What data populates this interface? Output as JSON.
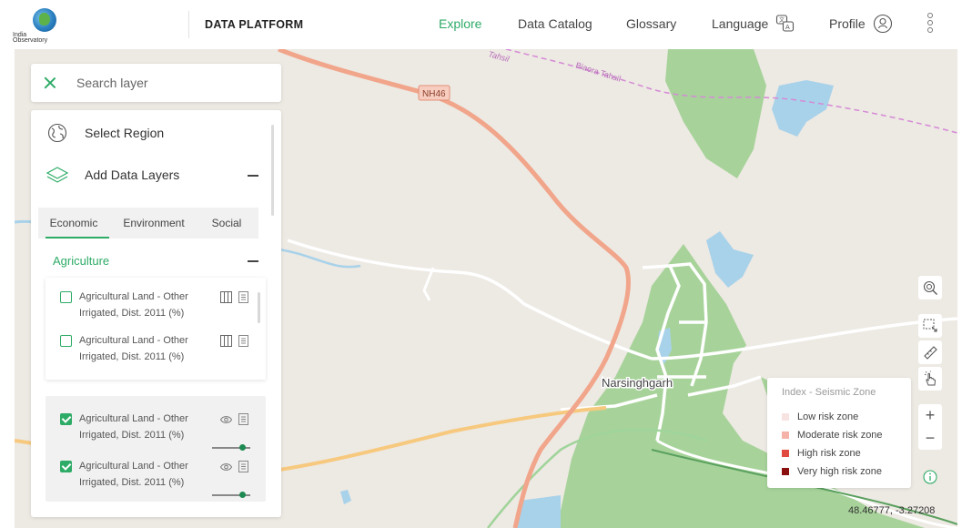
{
  "header": {
    "logo_line1": "India",
    "logo_line2": "Observatory",
    "brand": "DATA PLATFORM",
    "nav": [
      {
        "label": "Explore",
        "active": true
      },
      {
        "label": "Data Catalog"
      },
      {
        "label": "Glossary"
      },
      {
        "label": "Language"
      },
      {
        "label": "Profile"
      }
    ]
  },
  "map_labels": {
    "tahsil_fragment": "Tahsil",
    "biaora": "Biaora Tahsil",
    "highway": "NH46",
    "town": "Narsinghgarh"
  },
  "search": {
    "placeholder": "Search layer"
  },
  "panel": {
    "select_region": "Select Region",
    "add_layers": "Add Data Layers",
    "tabs": [
      "Economic",
      "Environment",
      "Social"
    ],
    "category": "Agriculture",
    "available_layers": [
      {
        "line1": "Agricultural Land - Other",
        "line2": "Irrigated, Dist. 2011 (%)",
        "checked": false
      },
      {
        "line1": "Agricultural Land - Other",
        "line2": "Irrigated, Dist. 2011 (%)",
        "checked": false
      }
    ],
    "active_layers": [
      {
        "line1": "Agricultural Land - Other",
        "line2": "Irrigated, Dist. 2011 (%)",
        "checked": true,
        "opacity": 0.75
      },
      {
        "line1": "Agricultural Land - Other",
        "line2": "Irrigated, Dist. 2011 (%)",
        "checked": true,
        "opacity": 0.75
      }
    ]
  },
  "legend": {
    "title": "Index - Seismic Zone",
    "items": [
      {
        "label": "Low risk zone",
        "color": "#f7e4e2"
      },
      {
        "label": "Moderate risk zone",
        "color": "#f5b2a8"
      },
      {
        "label": "High risk zone",
        "color": "#e04a3f"
      },
      {
        "label": "Very high risk zone",
        "color": "#8a0f0f"
      }
    ]
  },
  "zoom": {
    "in": "+",
    "out": "−"
  },
  "coordinates": "48.46777, -3.27208",
  "colors": {
    "accent": "#2eab67",
    "map_bg": "#ede9e3",
    "forest": "#a7d39a",
    "water": "#a8d2ea",
    "highway": "#f1a58a"
  }
}
